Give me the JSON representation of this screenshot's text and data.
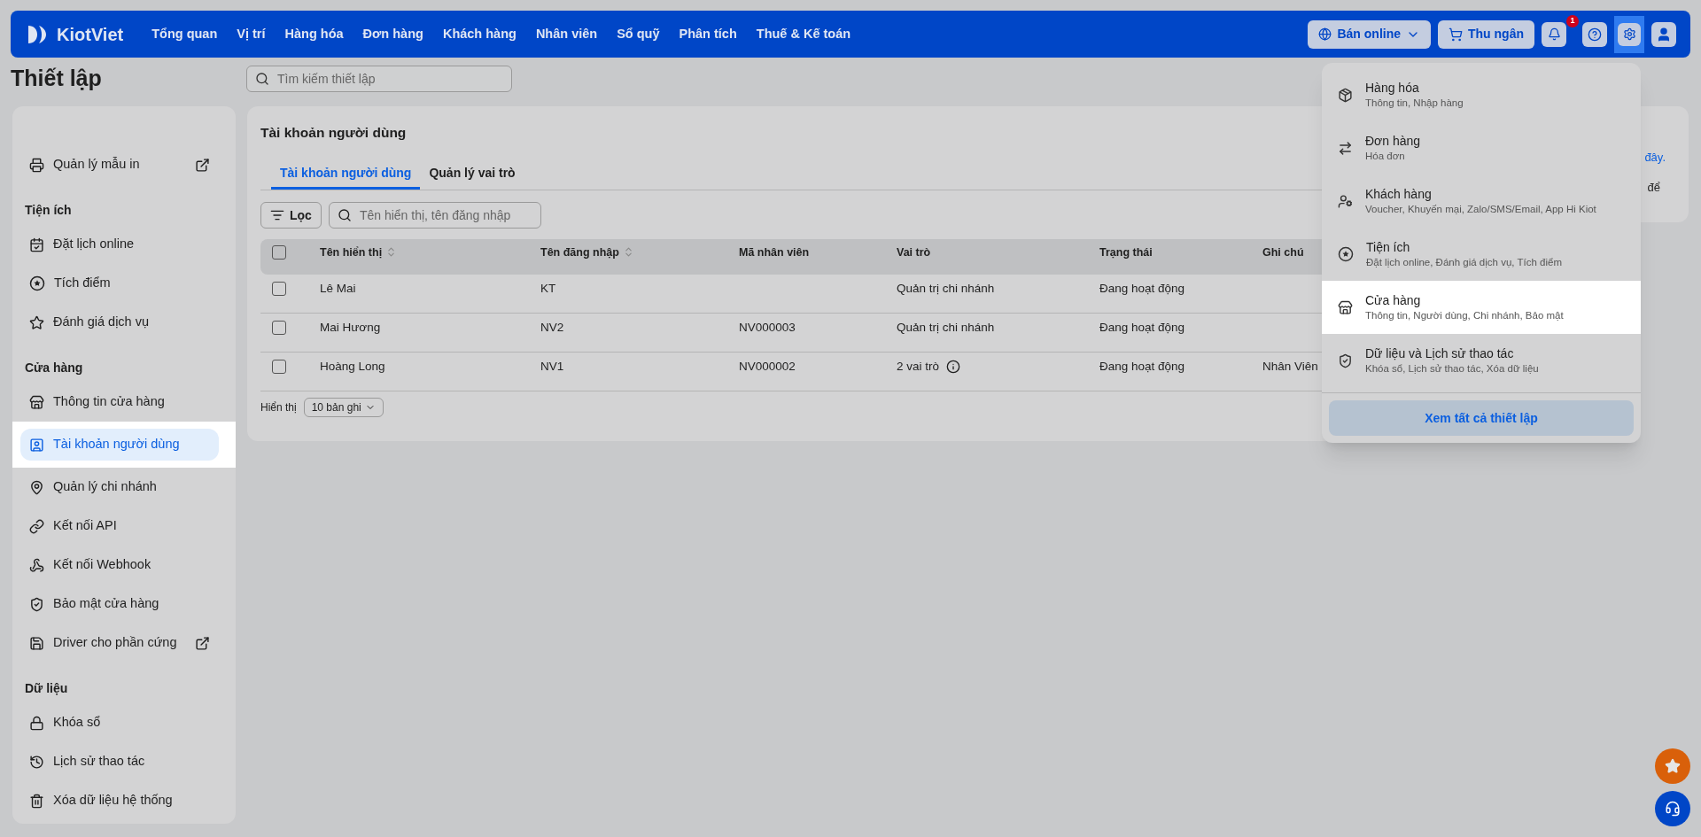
{
  "topbar": {
    "logo": "KiotViet",
    "menu": [
      {
        "label": "Tổng quan"
      },
      {
        "label": "Vị trí"
      },
      {
        "label": "Hàng hóa"
      },
      {
        "label": "Đơn hàng"
      },
      {
        "label": "Khách hàng"
      },
      {
        "label": "Nhân viên"
      },
      {
        "label": "Sổ quỹ"
      },
      {
        "label": "Phân tích"
      },
      {
        "label": "Thuế & Kế toán"
      }
    ],
    "online_button": "Bán online",
    "cashier_button": "Thu ngân",
    "notification_count": "1",
    "settings_open": true
  },
  "page_title": "Thiết lập",
  "search": {
    "placeholder": "Tìm kiếm thiết lập"
  },
  "sidebar": {
    "groups": [
      {
        "items": [
          {
            "label": "Quản lý mẫu in",
            "external": true,
            "selected": false
          }
        ]
      },
      {
        "title": "Tiện ích",
        "items": [
          {
            "label": "Đặt lịch online",
            "external": false,
            "selected": false
          },
          {
            "label": "Tích điểm",
            "external": false,
            "selected": false
          },
          {
            "label": "Đánh giá dịch vụ",
            "external": false,
            "selected": false
          }
        ]
      },
      {
        "title": "Cửa hàng",
        "items": [
          {
            "label": "Thông tin cửa hàng",
            "external": false,
            "selected": false
          },
          {
            "label": "Tài khoản người dùng",
            "external": false,
            "selected": true
          },
          {
            "label": "Quản lý chi nhánh",
            "external": false,
            "selected": false
          },
          {
            "label": "Kết nối API",
            "external": false,
            "selected": false
          },
          {
            "label": "Kết nối Webhook",
            "external": false,
            "selected": false
          },
          {
            "label": "Bảo mật cửa hàng",
            "external": false,
            "selected": false
          },
          {
            "label": "Driver cho phần cứng",
            "external": true,
            "selected": false
          }
        ]
      },
      {
        "title": "Dữ liệu",
        "items": [
          {
            "label": "Khóa sổ",
            "external": false,
            "selected": false
          },
          {
            "label": "Lịch sử thao tác",
            "external": false,
            "selected": false
          },
          {
            "label": "Xóa dữ liệu hệ thống",
            "external": false,
            "selected": false
          }
        ]
      }
    ]
  },
  "panel": {
    "title": "Tài khoản người dùng",
    "tabs": [
      {
        "label": "Tài khoản người dùng",
        "selected": true
      },
      {
        "label": "Quản lý vai trò",
        "selected": false
      }
    ],
    "filter_button": "Lọc",
    "search_placeholder": "Tên hiển thị, tên đăng nhập",
    "table": {
      "all_checked": false,
      "columns": [
        {
          "label": "Tên hiển thị",
          "sortable": true
        },
        {
          "label": "Tên đăng nhập",
          "sortable": true
        },
        {
          "label": "Mã nhân viên",
          "sortable": false
        },
        {
          "label": "Vai trò",
          "sortable": false
        },
        {
          "label": "Trạng thái",
          "sortable": false
        },
        {
          "label": "Ghi chú",
          "sortable": false
        }
      ],
      "rows": [
        {
          "checked": false,
          "cells": [
            "Lê Mai",
            "KT",
            "",
            "Quản trị chi nhánh",
            "Đang hoạt động",
            ""
          ],
          "role_info": false
        },
        {
          "checked": false,
          "cells": [
            "Mai Hương",
            "NV2",
            "NV000003",
            "Quản trị chi nhánh",
            "Đang hoạt động",
            ""
          ],
          "role_info": false
        },
        {
          "checked": false,
          "cells": [
            "Hoàng Long",
            "NV1",
            "NV000002",
            "2 vai trò",
            "Đang hoạt động",
            "Nhân Viên"
          ],
          "role_info": true
        }
      ]
    },
    "page_size_label": "Hiển thị",
    "page_size": "10 bản ghi"
  },
  "side_card": {
    "link_fragment": "đây.",
    "text_fragment": "để"
  },
  "settings_menu": {
    "items": [
      {
        "title": "Hàng hóa",
        "subtitle": "Thông tin, Nhập hàng",
        "selected": false
      },
      {
        "title": "Đơn hàng",
        "subtitle": "Hóa đơn",
        "selected": false
      },
      {
        "title": "Khách hàng",
        "subtitle": "Voucher, Khuyến mại, Zalo/SMS/Email, App Hi Kiot",
        "selected": false
      },
      {
        "title": "Tiện ích",
        "subtitle": "Đặt lịch online, Đánh giá dịch vụ, Tích điểm",
        "selected": false
      },
      {
        "title": "Cửa hàng",
        "subtitle": "Thông tin, Người dùng, Chi nhánh, Bảo mật",
        "selected": true
      },
      {
        "title": "Dữ liệu và Lịch sử thao tác",
        "subtitle": "Khóa sổ, Lịch sử thao tác, Xóa dữ liệu",
        "selected": false
      }
    ],
    "footer_button": "Xem tất cả thiết lập"
  }
}
